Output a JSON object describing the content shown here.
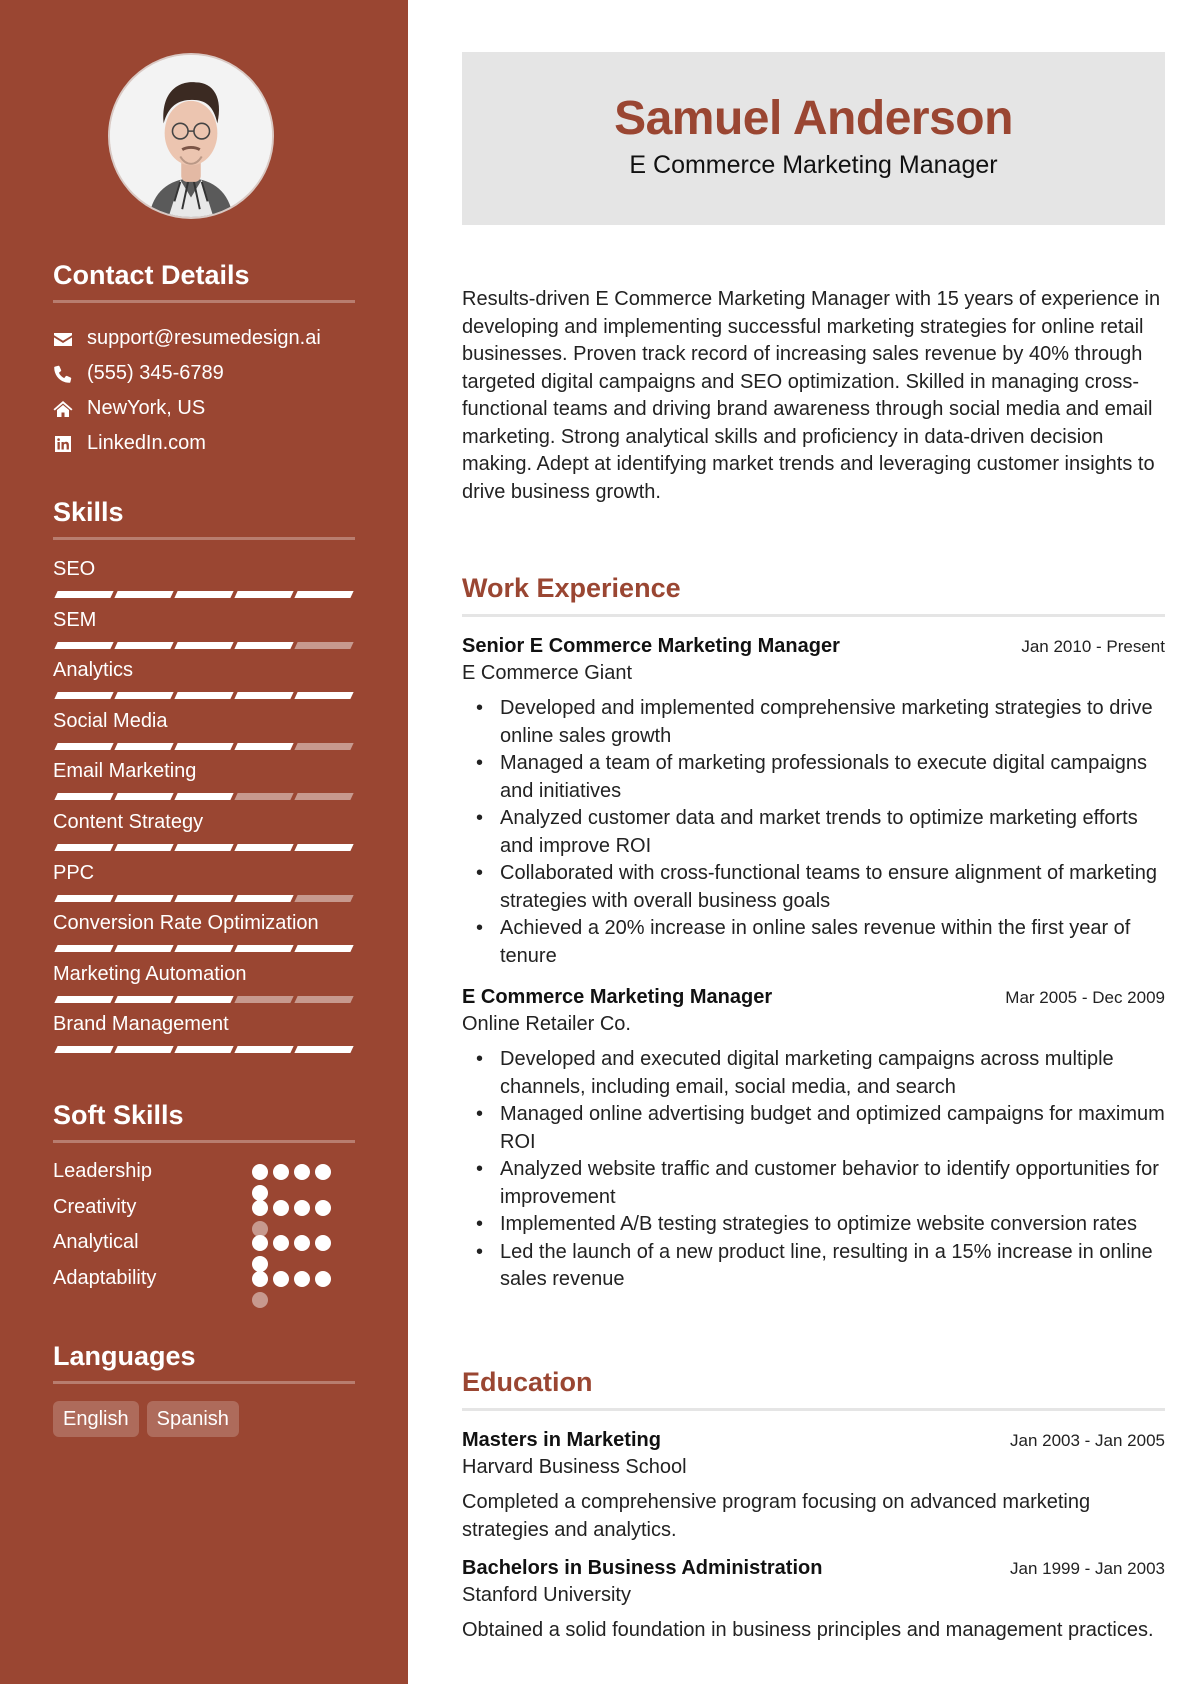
{
  "profile": {
    "name": "Samuel Anderson",
    "title": "E Commerce Marketing Manager",
    "photo_alt": "Profile photo of Samuel Anderson"
  },
  "colors": {
    "accent": "#9a4632",
    "header_bg": "#e5e5e5"
  },
  "contact": {
    "title": "Contact Details",
    "items": [
      {
        "icon": "envelope-icon",
        "text": "support@resumedesign.ai"
      },
      {
        "icon": "phone-icon",
        "text": "(555) 345-6789"
      },
      {
        "icon": "home-icon",
        "text": "NewYork, US"
      },
      {
        "icon": "linkedin-icon",
        "text": "LinkedIn.com"
      }
    ]
  },
  "skills": {
    "title": "Skills",
    "max_level": 5,
    "items": [
      {
        "name": "SEO",
        "level": 5
      },
      {
        "name": "SEM",
        "level": 4
      },
      {
        "name": "Analytics",
        "level": 5
      },
      {
        "name": "Social Media",
        "level": 4
      },
      {
        "name": "Email Marketing",
        "level": 3
      },
      {
        "name": "Content Strategy",
        "level": 5
      },
      {
        "name": "PPC",
        "level": 4
      },
      {
        "name": "Conversion Rate Optimization",
        "level": 5
      },
      {
        "name": "Marketing Automation",
        "level": 3
      },
      {
        "name": "Brand Management",
        "level": 5
      }
    ]
  },
  "soft_skills": {
    "title": "Soft Skills",
    "max_level": 5,
    "items": [
      {
        "name": "Leadership",
        "level": 5
      },
      {
        "name": "Creativity",
        "level": 4
      },
      {
        "name": "Analytical",
        "level": 5
      },
      {
        "name": "Adaptability",
        "level": 4
      }
    ]
  },
  "languages": {
    "title": "Languages",
    "items": [
      "English",
      "Spanish"
    ]
  },
  "summary": "Results-driven E Commerce Marketing Manager with 15 years of experience in developing and implementing successful marketing strategies for online retail businesses. Proven track record of increasing sales revenue by 40% through targeted digital campaigns and SEO optimization. Skilled in managing cross-functional teams and driving brand awareness through social media and email marketing. Strong analytical skills and proficiency in data-driven decision making. Adept at identifying market trends and leveraging customer insights to drive business growth.",
  "experience": {
    "title": "Work Experience",
    "jobs": [
      {
        "title": "Senior E Commerce Marketing Manager",
        "company": "E Commerce Giant",
        "dates": "Jan 2010 - Present",
        "bullets": [
          "Developed and implemented comprehensive marketing strategies to drive online sales growth",
          "Managed a team of marketing professionals to execute digital campaigns and initiatives",
          "Analyzed customer data and market trends to optimize marketing efforts and improve ROI",
          "Collaborated with cross-functional teams to ensure alignment of marketing strategies with overall business goals",
          "Achieved a 20% increase in online sales revenue within the first year of tenure"
        ]
      },
      {
        "title": "E Commerce Marketing Manager",
        "company": "Online Retailer Co.",
        "dates": "Mar 2005 - Dec 2009",
        "bullets": [
          "Developed and executed digital marketing campaigns across multiple channels, including email, social media, and search",
          "Managed online advertising budget and optimized campaigns for maximum ROI",
          "Analyzed website traffic and customer behavior to identify opportunities for improvement",
          "Implemented A/B testing strategies to optimize website conversion rates",
          "Led the launch of a new product line, resulting in a 15% increase in online sales revenue"
        ]
      }
    ]
  },
  "education": {
    "title": "Education",
    "items": [
      {
        "degree": "Masters in Marketing",
        "school": "Harvard Business School",
        "dates": "Jan 2003 - Jan 2005",
        "description": "Completed a comprehensive program focusing on advanced marketing strategies and analytics."
      },
      {
        "degree": "Bachelors in Business Administration",
        "school": "Stanford University",
        "dates": "Jan 1999 - Jan 2003",
        "description": "Obtained a solid foundation in business principles and management practices."
      }
    ]
  }
}
